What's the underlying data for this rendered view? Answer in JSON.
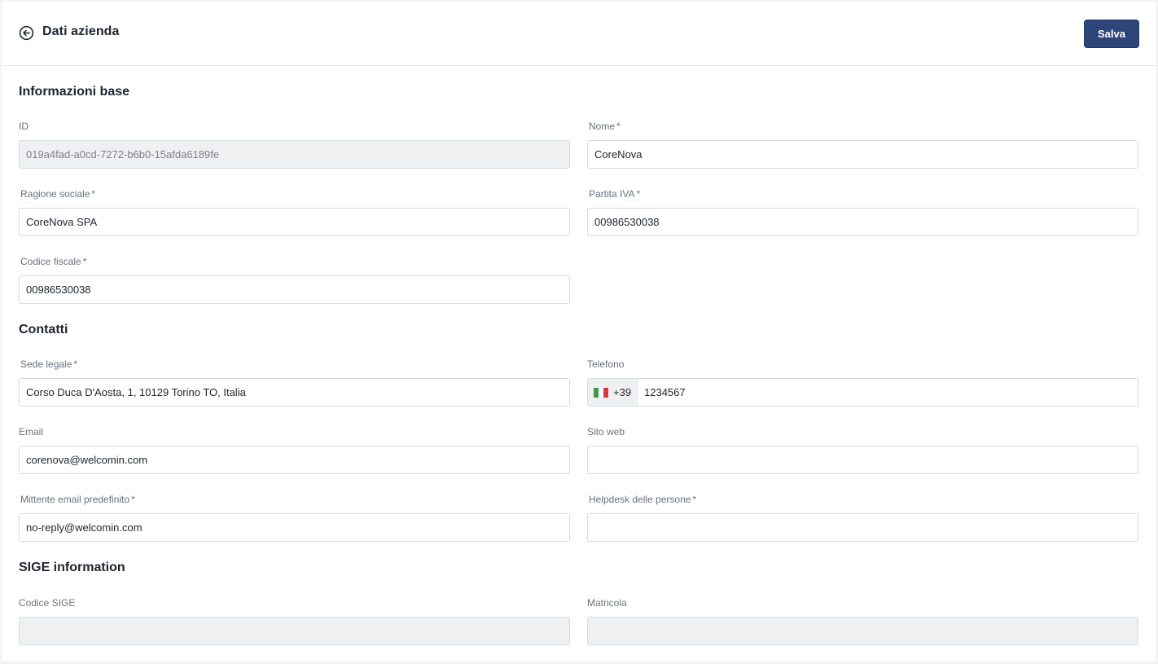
{
  "header": {
    "title": "Dati azienda",
    "save_label": "Salva"
  },
  "sections": {
    "base": "Informazioni base",
    "contacts": "Contatti",
    "sige": "SIGE information"
  },
  "fields": {
    "id": {
      "label": "ID",
      "value": "019a4fad-a0cd-7272-b6b0-15afda6189fe"
    },
    "nome": {
      "label": "Nome",
      "value": "CoreNova"
    },
    "ragione_sociale": {
      "label": "Ragione sociale",
      "value": "CoreNova SPA"
    },
    "partita_iva": {
      "label": "Partita IVA",
      "value": "00986530038"
    },
    "codice_fiscale": {
      "label": "Codice fiscale",
      "value": "00986530038"
    },
    "sede_legale": {
      "label": "Sede legale",
      "value": "Corso Duca D'Aosta, 1, 10129 Torino TO, Italia"
    },
    "telefono": {
      "label": "Telefono",
      "prefix": "+39",
      "value": "1234567"
    },
    "email": {
      "label": "Email",
      "value": "corenova@welcomin.com"
    },
    "sito_web": {
      "label": "Sito web",
      "value": ""
    },
    "mittente_email": {
      "label": "Mittente email predefinito",
      "value": "no-reply@welcomin.com"
    },
    "helpdesk": {
      "label": "Helpdesk delle persone",
      "value": ""
    },
    "codice_sige": {
      "label": "Codice SIGE",
      "value": ""
    },
    "matricola": {
      "label": "Matricola",
      "value": ""
    }
  },
  "required_marker": "*",
  "colors": {
    "primary": "#2e4578",
    "disabled_bg": "#eff0f2",
    "border": "#d7dade",
    "flag_green": "#3c9a48",
    "flag_white": "#ffffff",
    "flag_red": "#d33b3b"
  },
  "icons": {
    "back": "arrow-left-circle-icon",
    "flag": "italy-flag-icon"
  }
}
